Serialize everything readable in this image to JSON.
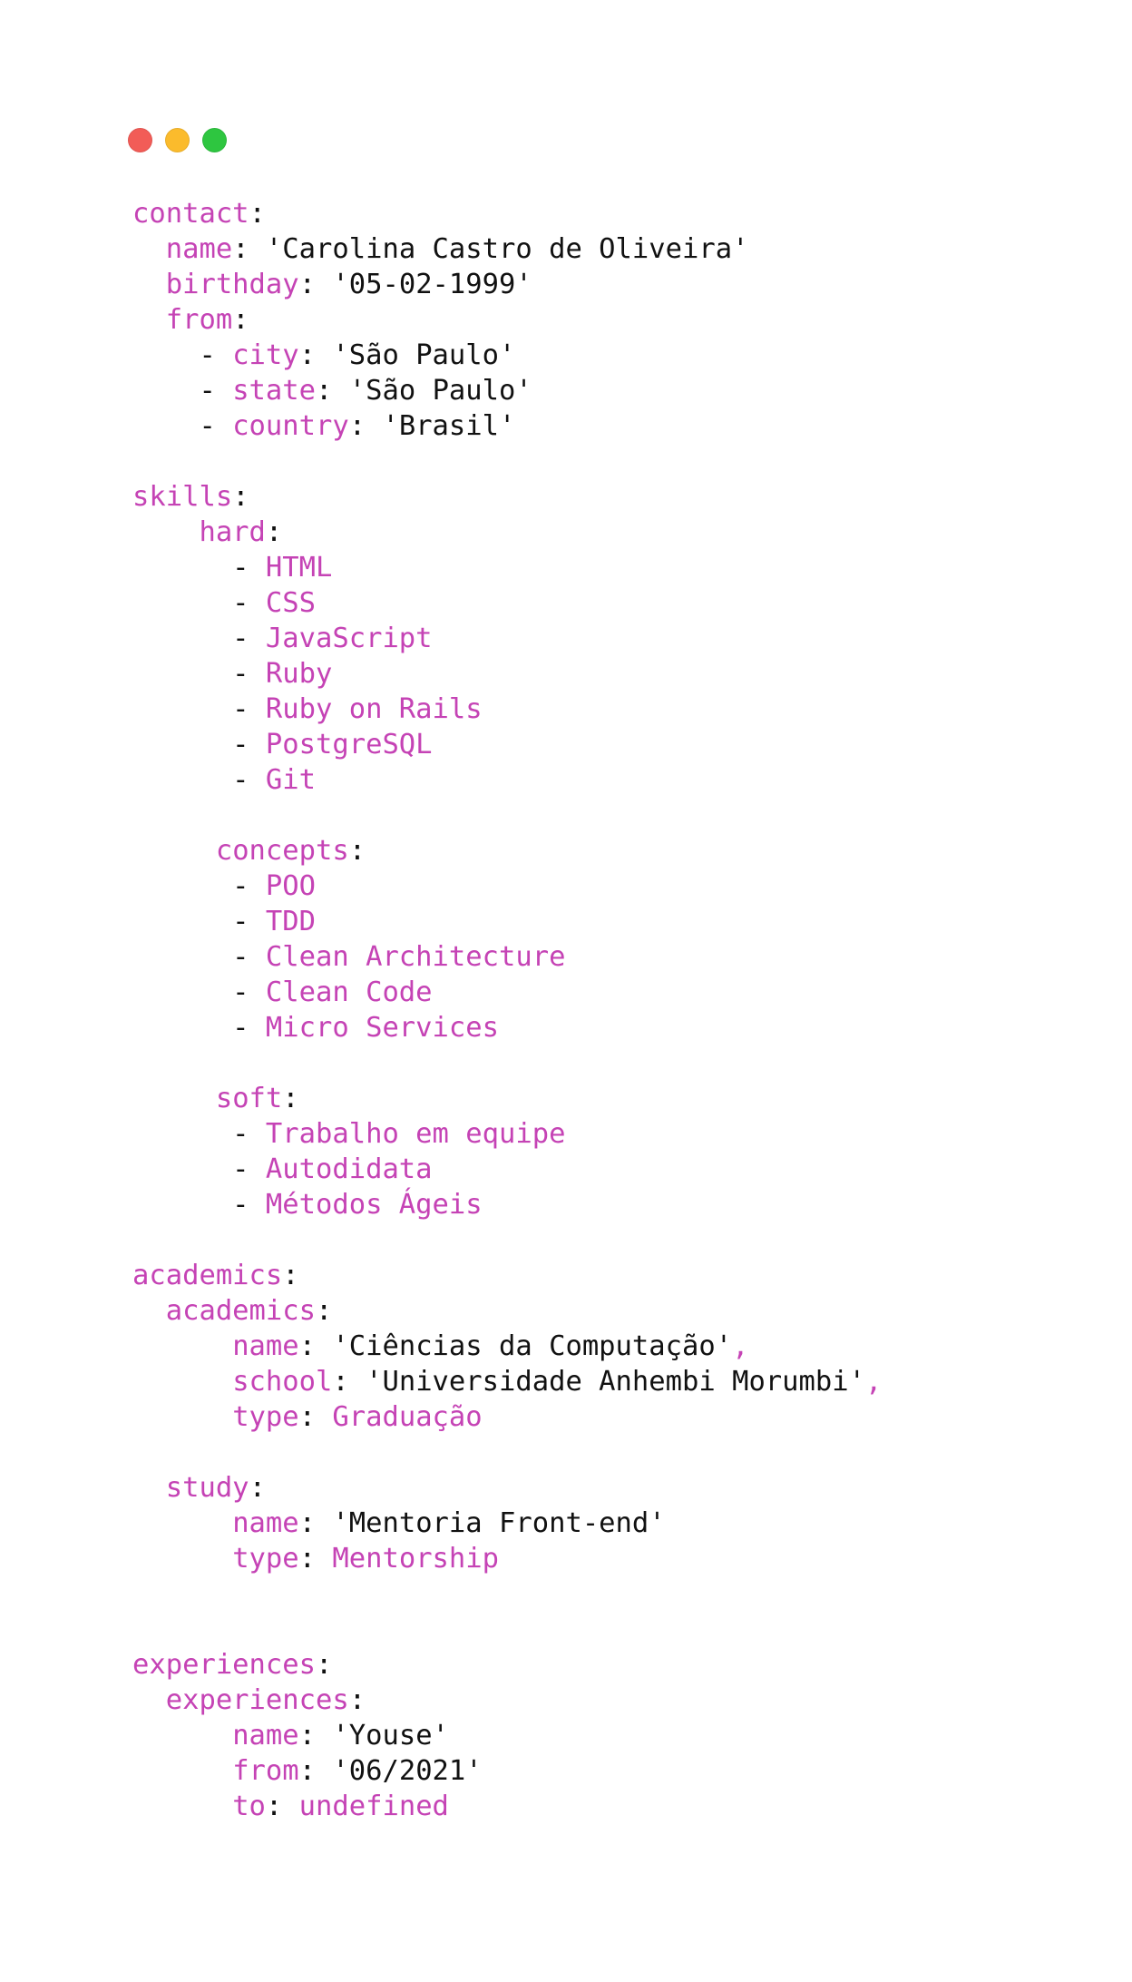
{
  "window": {
    "buttons": [
      {
        "name": "close",
        "color": "#f25c57"
      },
      {
        "name": "minimize",
        "color": "#fbbb2c"
      },
      {
        "name": "zoom",
        "color": "#2ec640"
      }
    ]
  },
  "colors": {
    "key": "#c543b5",
    "text": "#111111",
    "background": "#ffffff"
  },
  "lines": [
    [
      {
        "t": "contact",
        "c": "k"
      },
      {
        "t": ":",
        "c": "p"
      }
    ],
    [
      {
        "t": "  "
      },
      {
        "t": "name",
        "c": "k"
      },
      {
        "t": ": ",
        "c": "p"
      },
      {
        "t": "'Carolina Castro de Oliveira'",
        "c": "s"
      }
    ],
    [
      {
        "t": "  "
      },
      {
        "t": "birthday",
        "c": "k"
      },
      {
        "t": ": ",
        "c": "p"
      },
      {
        "t": "'05-02-1999'",
        "c": "s"
      }
    ],
    [
      {
        "t": "  "
      },
      {
        "t": "from",
        "c": "k"
      },
      {
        "t": ":",
        "c": "p"
      }
    ],
    [
      {
        "t": "    - ",
        "c": "p"
      },
      {
        "t": "city",
        "c": "k"
      },
      {
        "t": ": ",
        "c": "p"
      },
      {
        "t": "'São Paulo'",
        "c": "s"
      }
    ],
    [
      {
        "t": "    - ",
        "c": "p"
      },
      {
        "t": "state",
        "c": "k"
      },
      {
        "t": ": ",
        "c": "p"
      },
      {
        "t": "'São Paulo'",
        "c": "s"
      }
    ],
    [
      {
        "t": "    - ",
        "c": "p"
      },
      {
        "t": "country",
        "c": "k"
      },
      {
        "t": ": ",
        "c": "p"
      },
      {
        "t": "'Brasil'",
        "c": "s"
      }
    ],
    [],
    [
      {
        "t": "skills",
        "c": "k"
      },
      {
        "t": ":",
        "c": "p"
      }
    ],
    [
      {
        "t": "    "
      },
      {
        "t": "hard",
        "c": "k"
      },
      {
        "t": ":",
        "c": "p"
      }
    ],
    [
      {
        "t": "      - ",
        "c": "p"
      },
      {
        "t": "HTML",
        "c": "v"
      }
    ],
    [
      {
        "t": "      - ",
        "c": "p"
      },
      {
        "t": "CSS",
        "c": "v"
      }
    ],
    [
      {
        "t": "      - ",
        "c": "p"
      },
      {
        "t": "JavaScript",
        "c": "v"
      }
    ],
    [
      {
        "t": "      - ",
        "c": "p"
      },
      {
        "t": "Ruby",
        "c": "v"
      }
    ],
    [
      {
        "t": "      - ",
        "c": "p"
      },
      {
        "t": "Ruby on Rails",
        "c": "v"
      }
    ],
    [
      {
        "t": "      - ",
        "c": "p"
      },
      {
        "t": "PostgreSQL",
        "c": "v"
      }
    ],
    [
      {
        "t": "      - ",
        "c": "p"
      },
      {
        "t": "Git",
        "c": "v"
      }
    ],
    [],
    [
      {
        "t": "     "
      },
      {
        "t": "concepts",
        "c": "k"
      },
      {
        "t": ":",
        "c": "p"
      }
    ],
    [
      {
        "t": "      - ",
        "c": "p"
      },
      {
        "t": "POO",
        "c": "v"
      }
    ],
    [
      {
        "t": "      - ",
        "c": "p"
      },
      {
        "t": "TDD",
        "c": "v"
      }
    ],
    [
      {
        "t": "      - ",
        "c": "p"
      },
      {
        "t": "Clean Architecture",
        "c": "v"
      }
    ],
    [
      {
        "t": "      - ",
        "c": "p"
      },
      {
        "t": "Clean Code",
        "c": "v"
      }
    ],
    [
      {
        "t": "      - ",
        "c": "p"
      },
      {
        "t": "Micro Services",
        "c": "v"
      }
    ],
    [],
    [
      {
        "t": "     "
      },
      {
        "t": "soft",
        "c": "k"
      },
      {
        "t": ":",
        "c": "p"
      }
    ],
    [
      {
        "t": "      - ",
        "c": "p"
      },
      {
        "t": "Trabalho em equipe",
        "c": "v"
      }
    ],
    [
      {
        "t": "      - ",
        "c": "p"
      },
      {
        "t": "Autodidata",
        "c": "v"
      }
    ],
    [
      {
        "t": "      - ",
        "c": "p"
      },
      {
        "t": "Métodos Ágeis",
        "c": "v"
      }
    ],
    [],
    [
      {
        "t": "academics",
        "c": "k"
      },
      {
        "t": ":",
        "c": "p"
      }
    ],
    [
      {
        "t": "  "
      },
      {
        "t": "academics",
        "c": "k"
      },
      {
        "t": ":",
        "c": "p"
      }
    ],
    [
      {
        "t": "      "
      },
      {
        "t": "name",
        "c": "k"
      },
      {
        "t": ": ",
        "c": "p"
      },
      {
        "t": "'Ciências da Computação'",
        "c": "s"
      },
      {
        "t": ",",
        "c": "k"
      }
    ],
    [
      {
        "t": "      "
      },
      {
        "t": "school",
        "c": "k"
      },
      {
        "t": ": ",
        "c": "p"
      },
      {
        "t": "'Universidade Anhembi Morumbi'",
        "c": "s"
      },
      {
        "t": ",",
        "c": "k"
      }
    ],
    [
      {
        "t": "      "
      },
      {
        "t": "type",
        "c": "k"
      },
      {
        "t": ": ",
        "c": "p"
      },
      {
        "t": "Graduação",
        "c": "v"
      }
    ],
    [],
    [
      {
        "t": "  "
      },
      {
        "t": "study",
        "c": "k"
      },
      {
        "t": ":",
        "c": "p"
      }
    ],
    [
      {
        "t": "      "
      },
      {
        "t": "name",
        "c": "k"
      },
      {
        "t": ": ",
        "c": "p"
      },
      {
        "t": "'Mentoria Front-end'",
        "c": "s"
      }
    ],
    [
      {
        "t": "      "
      },
      {
        "t": "type",
        "c": "k"
      },
      {
        "t": ": ",
        "c": "p"
      },
      {
        "t": "Mentorship",
        "c": "v"
      }
    ],
    [],
    [],
    [
      {
        "t": "experiences",
        "c": "k"
      },
      {
        "t": ":",
        "c": "p"
      }
    ],
    [
      {
        "t": "  "
      },
      {
        "t": "experiences",
        "c": "k"
      },
      {
        "t": ":",
        "c": "p"
      }
    ],
    [
      {
        "t": "      "
      },
      {
        "t": "name",
        "c": "k"
      },
      {
        "t": ": ",
        "c": "p"
      },
      {
        "t": "'Youse'",
        "c": "s"
      }
    ],
    [
      {
        "t": "      "
      },
      {
        "t": "from",
        "c": "k"
      },
      {
        "t": ": ",
        "c": "p"
      },
      {
        "t": "'06/2021'",
        "c": "s"
      }
    ],
    [
      {
        "t": "      "
      },
      {
        "t": "to",
        "c": "k"
      },
      {
        "t": ": ",
        "c": "p"
      },
      {
        "t": "undefined",
        "c": "v"
      }
    ]
  ]
}
